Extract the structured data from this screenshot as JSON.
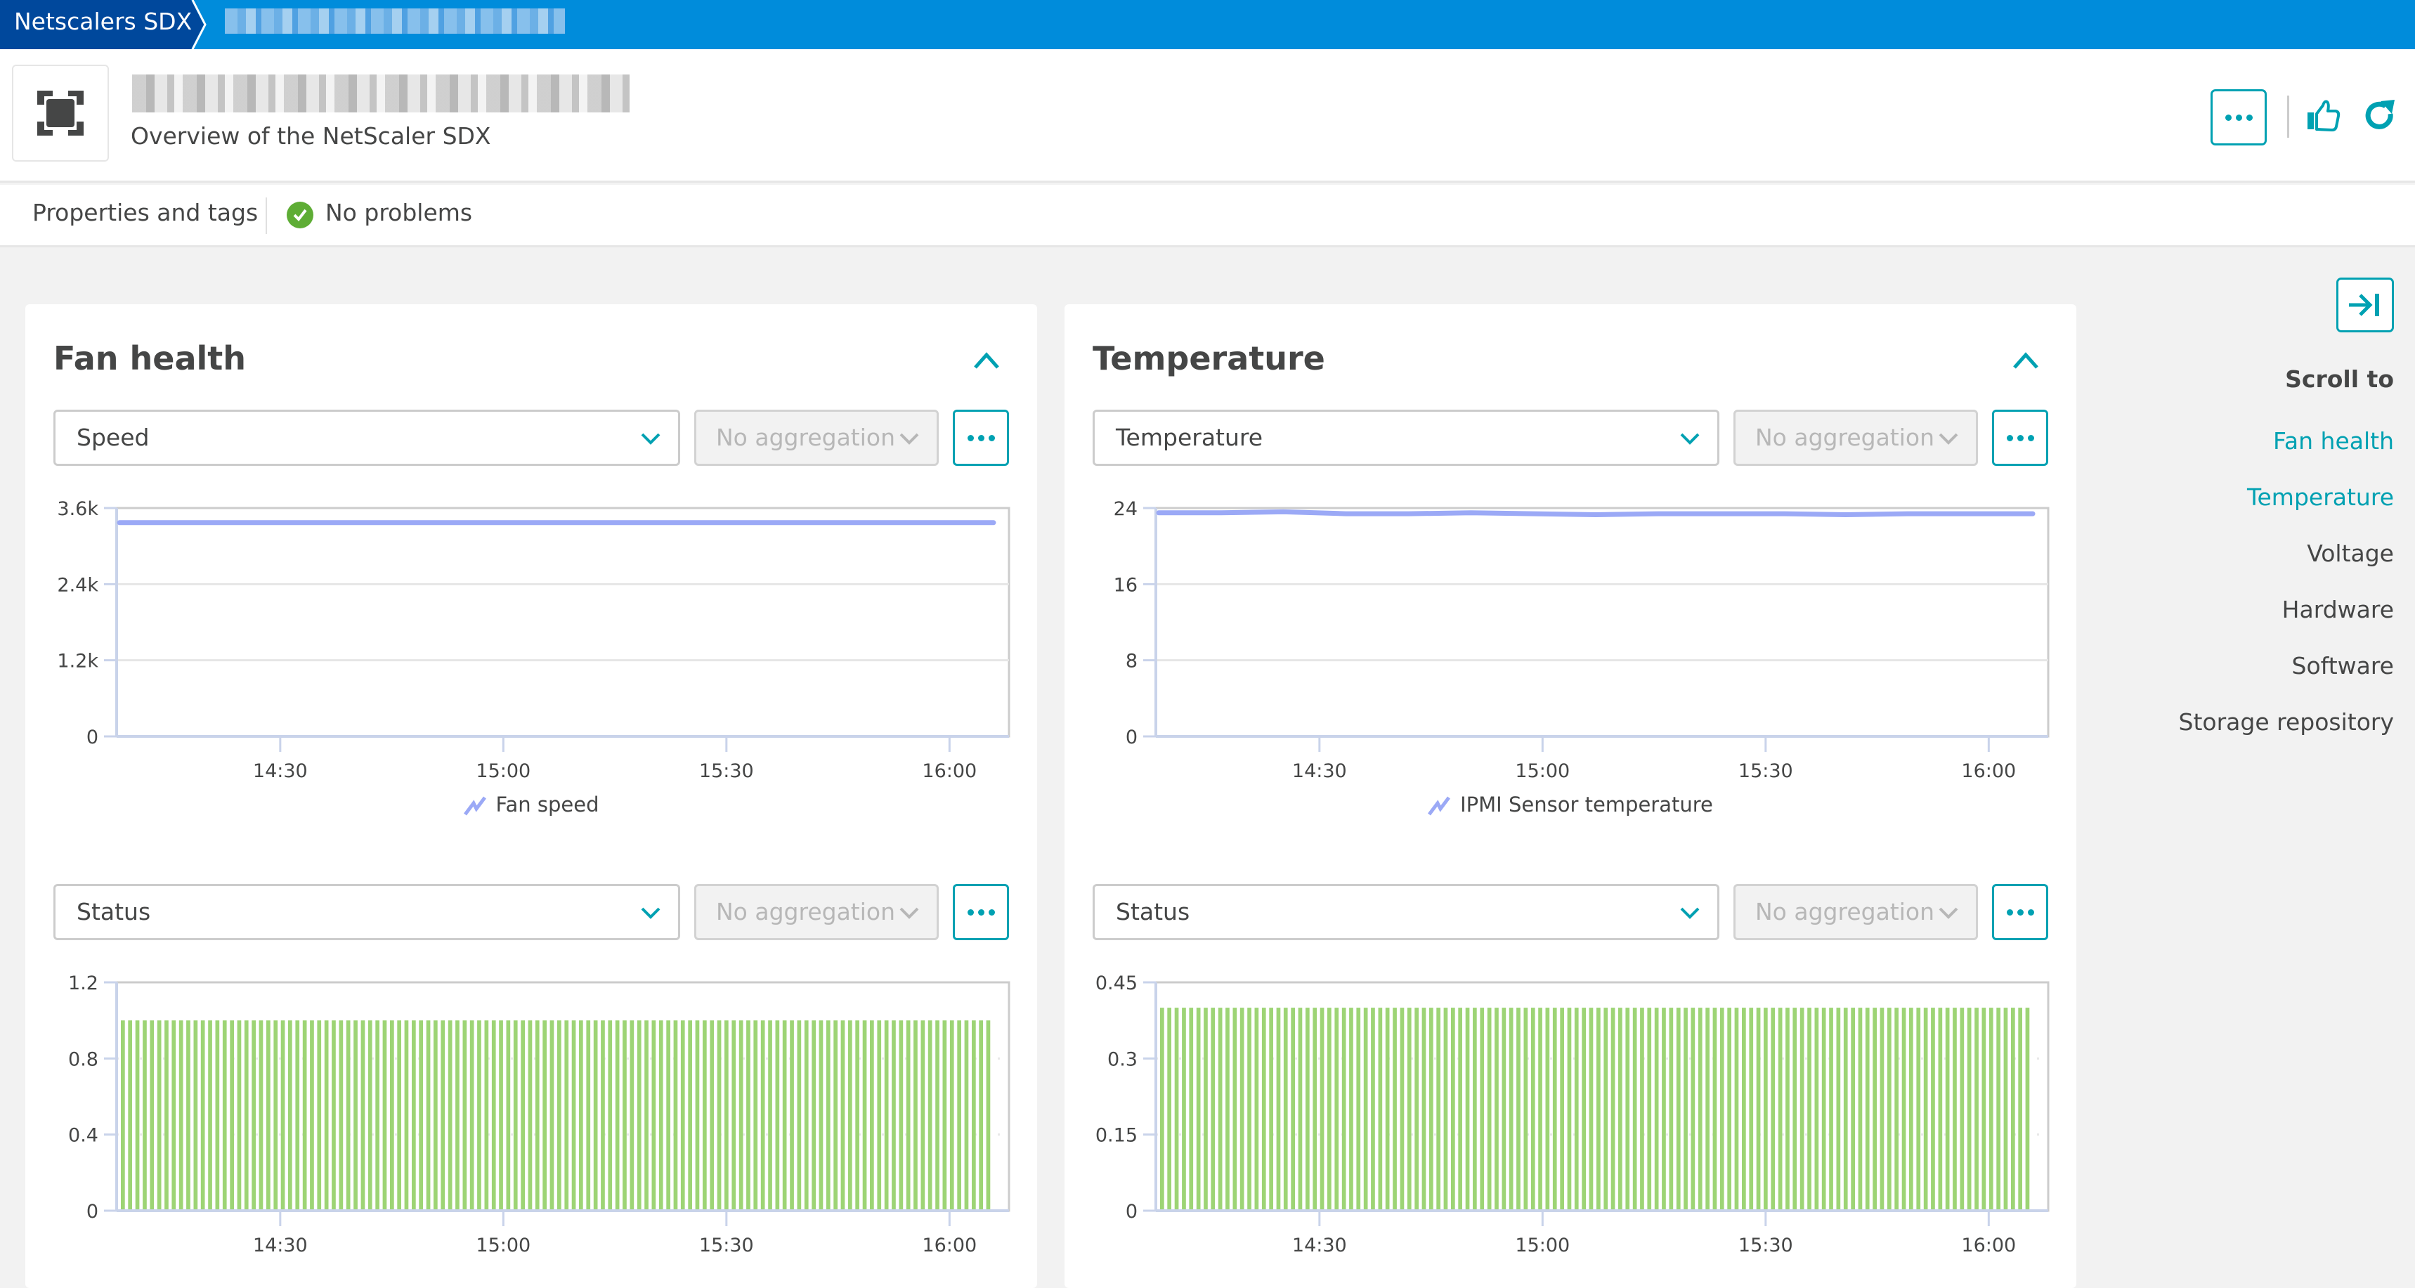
{
  "breadcrumb": {
    "root": "Netscalers SDX",
    "current": "[redacted hostname]"
  },
  "header": {
    "title": "[redacted hostname]",
    "subtitle": "Overview of the NetScaler SDX",
    "icon": "netscaler-device-icon",
    "more_icon": "more-icon",
    "like_icon": "thumbs-up-icon",
    "refresh_icon": "refresh-icon"
  },
  "propbar": {
    "properties_label": "Properties and tags",
    "problems_label": "No problems",
    "problems_icon": "check-circle-icon"
  },
  "colors": {
    "accent": "#00a1b2",
    "topbar": "#008cdb",
    "breadcrumb_root": "#00489c",
    "line_series": "#9ba9f6",
    "bar_series": "#9dd475",
    "ok_green": "#5ead35"
  },
  "panels": [
    {
      "title": "Fan health",
      "charts": [
        {
          "metric": "Speed",
          "aggregation": "No aggregation"
        },
        {
          "metric": "Status",
          "aggregation": "No aggregation"
        }
      ]
    },
    {
      "title": "Temperature",
      "charts": [
        {
          "metric": "Temperature",
          "aggregation": "No aggregation"
        },
        {
          "metric": "Status",
          "aggregation": "No aggregation"
        }
      ]
    }
  ],
  "sidebar": {
    "scroll_to_label": "Scroll to",
    "items": [
      {
        "label": "Fan health",
        "active": true
      },
      {
        "label": "Temperature",
        "active": true
      },
      {
        "label": "Voltage",
        "active": false
      },
      {
        "label": "Hardware",
        "active": false
      },
      {
        "label": "Software",
        "active": false
      },
      {
        "label": "Storage repository",
        "active": false
      }
    ]
  },
  "chart_data": [
    {
      "type": "line",
      "title": "Speed",
      "legend": [
        "Fan speed"
      ],
      "x_ticks": [
        "14:30",
        "15:00",
        "15:30",
        "16:00"
      ],
      "x_range": [
        "14:08",
        "16:08"
      ],
      "y_ticks": [
        "0",
        "1.2k",
        "2.4k",
        "3.6k"
      ],
      "ylim": [
        0,
        3600
      ],
      "grid": true,
      "series": [
        {
          "name": "Fan speed",
          "x_start": "14:08",
          "x_end": "16:06",
          "values": [
            3370,
            3370,
            3370,
            3370,
            3370,
            3370,
            3370,
            3370,
            3370,
            3370,
            3370,
            3370,
            3370
          ]
        }
      ]
    },
    {
      "type": "bar",
      "title": "Fan Status",
      "x_ticks": [
        "14:30",
        "15:00",
        "15:30",
        "16:00"
      ],
      "y_ticks": [
        "0",
        "0.4",
        "0.8",
        "1.2"
      ],
      "ylim": [
        0,
        1.2
      ],
      "grid": true,
      "bar_count": 120,
      "bar_value": 1
    },
    {
      "type": "line",
      "title": "Temperature",
      "legend": [
        "IPMI Sensor temperature"
      ],
      "x_ticks": [
        "14:30",
        "15:00",
        "15:30",
        "16:00"
      ],
      "y_ticks": [
        "0",
        "8",
        "16",
        "24"
      ],
      "ylim": [
        0,
        24
      ],
      "grid": true,
      "series": [
        {
          "name": "IPMI Sensor temperature",
          "values": [
            23.5,
            23.5,
            23.6,
            23.4,
            23.4,
            23.5,
            23.4,
            23.3,
            23.4,
            23.4,
            23.4,
            23.3,
            23.4,
            23.4,
            23.4
          ]
        }
      ]
    },
    {
      "type": "bar",
      "title": "Temperature Status",
      "x_ticks": [
        "14:30",
        "15:00",
        "15:30",
        "16:00"
      ],
      "y_ticks": [
        "0",
        "0.15",
        "0.3",
        "0.45"
      ],
      "ylim": [
        0,
        0.45
      ],
      "grid": true,
      "bar_count": 120,
      "bar_value": 0.4
    }
  ]
}
